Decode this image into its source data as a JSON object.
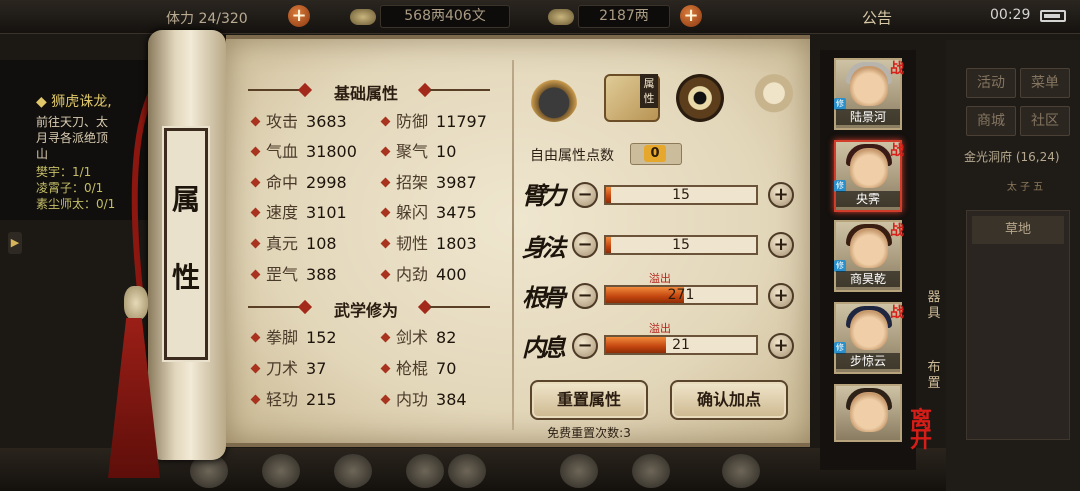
{
  "topbar": {
    "stamina_text": "体力 24/320",
    "silver": "568两406文",
    "gold": "2187两",
    "notice": "公告",
    "clock": "00:29"
  },
  "quest": {
    "title": "狮虎诛龙,",
    "desc1": "前往天刀、太",
    "desc2": "月寻各派绝顶",
    "desc3": "山",
    "req1": "樊宇：1/1",
    "req2": "凌霄子：0/1",
    "req3": "素尘师太：0/1"
  },
  "scroll_label": [
    "属",
    "性"
  ],
  "sections": {
    "basic": "基础属性",
    "martial": "武学修为"
  },
  "basic_stats": [
    {
      "label": "攻击",
      "value": "3683"
    },
    {
      "label": "防御",
      "value": "11797"
    },
    {
      "label": "气血",
      "value": "31800"
    },
    {
      "label": "聚气",
      "value": "10"
    },
    {
      "label": "命中",
      "value": "2998"
    },
    {
      "label": "招架",
      "value": "3987"
    },
    {
      "label": "速度",
      "value": "3101"
    },
    {
      "label": "躲闪",
      "value": "3475"
    },
    {
      "label": "真元",
      "value": "108"
    },
    {
      "label": "韧性",
      "value": "1803"
    },
    {
      "label": "罡气",
      "value": "388"
    },
    {
      "label": "内劲",
      "value": "400"
    }
  ],
  "martial_stats": [
    {
      "label": "拳脚",
      "value": "152"
    },
    {
      "label": "剑术",
      "value": "82"
    },
    {
      "label": "刀术",
      "value": "37"
    },
    {
      "label": "枪棍",
      "value": "70"
    },
    {
      "label": "轻功",
      "value": "215"
    },
    {
      "label": "内功",
      "value": "384"
    }
  ],
  "tabs": {
    "attr_tag": "属性"
  },
  "free_points": {
    "label": "自由属性点数",
    "value": "0"
  },
  "attributes": [
    {
      "name": "臂力",
      "value": "15",
      "fill": 0.03,
      "overflow": ""
    },
    {
      "name": "身法",
      "value": "15",
      "fill": 0.03,
      "overflow": ""
    },
    {
      "name": "根骨",
      "value": "271",
      "fill": 0.52,
      "overflow": "溢出"
    },
    {
      "name": "内息",
      "value": "21",
      "fill": 0.4,
      "overflow": "溢出"
    }
  ],
  "buttons": {
    "reset": "重置属性",
    "confirm": "确认加点",
    "reset_count": "免费重置次数:3"
  },
  "roster": [
    {
      "name": "陆景河",
      "tag": "战"
    },
    {
      "name": "央霁",
      "tag": "战"
    },
    {
      "name": "商昊乾",
      "tag": "战"
    },
    {
      "name": "步惊云",
      "tag": "战"
    },
    {
      "name": "",
      "tag": ""
    }
  ],
  "roster_leave": "离开",
  "side_labels": {
    "equip": "器具",
    "arrange": "布置"
  },
  "right_menu": {
    "activity": "活动",
    "menu": "菜单",
    "shop": "商城",
    "community": "社区",
    "location": "金光洞府 (16,24)",
    "compass": "太 子 五",
    "area": "草地"
  },
  "colors": {
    "accent_red": "#a8341f",
    "bar_fill": "#c2450f",
    "free_points_badge": "#e5a82d"
  }
}
